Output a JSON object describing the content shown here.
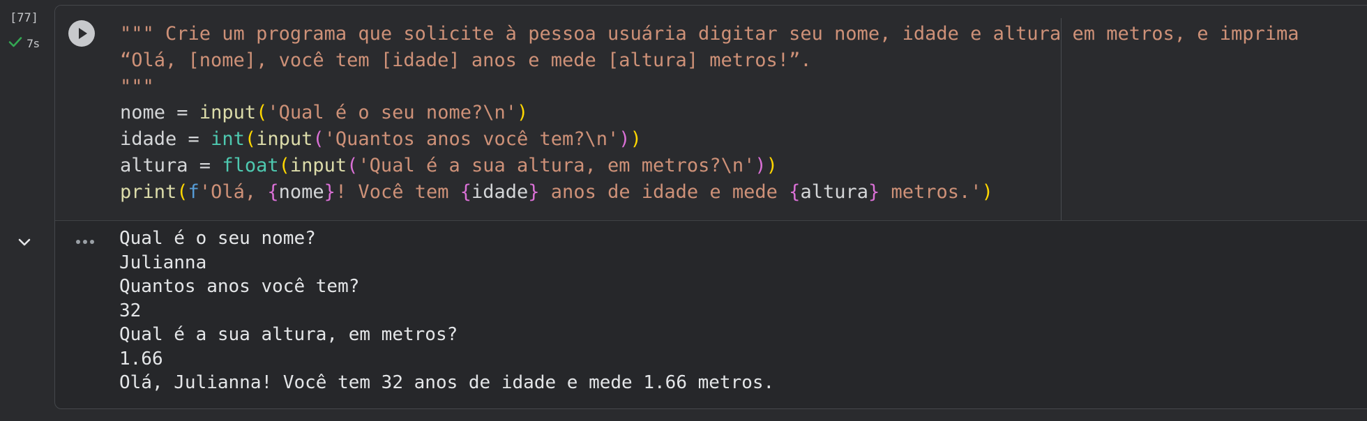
{
  "cell": {
    "execution_count": "[77]",
    "exec_time": "7s",
    "status": "success",
    "code_lines": [
      [
        {
          "t": "\"\"\" Crie um programa que solicite à pessoa usuária digitar seu nome, idade e altura em metros, e imprima",
          "c": "tk-str"
        }
      ],
      [
        {
          "t": "“Olá, [nome], você tem [idade] anos e mede [altura] metros!”.",
          "c": "tk-str"
        }
      ],
      [
        {
          "t": "\"\"\"",
          "c": "tk-str"
        }
      ],
      [
        {
          "t": "nome",
          "c": "tk-var"
        },
        {
          "t": " = ",
          "c": "tk-op"
        },
        {
          "t": "input",
          "c": "tk-fn"
        },
        {
          "t": "(",
          "c": "tk-p1"
        },
        {
          "t": "'Qual é o seu nome?\\n'",
          "c": "tk-str"
        },
        {
          "t": ")",
          "c": "tk-p1"
        }
      ],
      [
        {
          "t": "idade",
          "c": "tk-var"
        },
        {
          "t": " = ",
          "c": "tk-op"
        },
        {
          "t": "int",
          "c": "tk-type"
        },
        {
          "t": "(",
          "c": "tk-p1"
        },
        {
          "t": "input",
          "c": "tk-fn"
        },
        {
          "t": "(",
          "c": "tk-p2"
        },
        {
          "t": "'Quantos anos você tem?\\n'",
          "c": "tk-str"
        },
        {
          "t": ")",
          "c": "tk-p2"
        },
        {
          "t": ")",
          "c": "tk-p1"
        }
      ],
      [
        {
          "t": "altura",
          "c": "tk-var"
        },
        {
          "t": " = ",
          "c": "tk-op"
        },
        {
          "t": "float",
          "c": "tk-type"
        },
        {
          "t": "(",
          "c": "tk-p1"
        },
        {
          "t": "input",
          "c": "tk-fn"
        },
        {
          "t": "(",
          "c": "tk-p2"
        },
        {
          "t": "'Qual é a sua altura, em metros?\\n'",
          "c": "tk-str"
        },
        {
          "t": ")",
          "c": "tk-p2"
        },
        {
          "t": ")",
          "c": "tk-p1"
        }
      ],
      [
        {
          "t": "print",
          "c": "tk-fn"
        },
        {
          "t": "(",
          "c": "tk-p1"
        },
        {
          "t": "f",
          "c": "tk-fprefix"
        },
        {
          "t": "'Olá, ",
          "c": "tk-str"
        },
        {
          "t": "{",
          "c": "tk-p2"
        },
        {
          "t": "nome",
          "c": "tk-var"
        },
        {
          "t": "}",
          "c": "tk-p2"
        },
        {
          "t": "! Você tem ",
          "c": "tk-str"
        },
        {
          "t": "{",
          "c": "tk-p2"
        },
        {
          "t": "idade",
          "c": "tk-var"
        },
        {
          "t": "}",
          "c": "tk-p2"
        },
        {
          "t": " anos de idade e mede ",
          "c": "tk-str"
        },
        {
          "t": "{",
          "c": "tk-p2"
        },
        {
          "t": "altura",
          "c": "tk-var"
        },
        {
          "t": "}",
          "c": "tk-p2"
        },
        {
          "t": " metros.'",
          "c": "tk-str"
        },
        {
          "t": ")",
          "c": "tk-p1"
        }
      ]
    ],
    "output_lines": [
      "Qual é o seu nome?",
      "Julianna",
      "Quantos anos você tem?",
      "32",
      "Qual é a sua altura, em metros?",
      "1.66",
      "Olá, Julianna! Você tem 32 anos de idade e mede 1.66 metros."
    ]
  },
  "icons": {
    "run": "play-circle-icon",
    "status": "checkmark-icon",
    "collapse": "chevron-down-icon",
    "output_menu": "more-horiz-icon"
  },
  "colors": {
    "background": "#2a2b2e",
    "string": "#ce9178",
    "function": "#dcdcaa",
    "type": "#4ec9b0",
    "bracket_level1": "#ffd700",
    "bracket_level2": "#da70d6",
    "success": "#34a853"
  }
}
